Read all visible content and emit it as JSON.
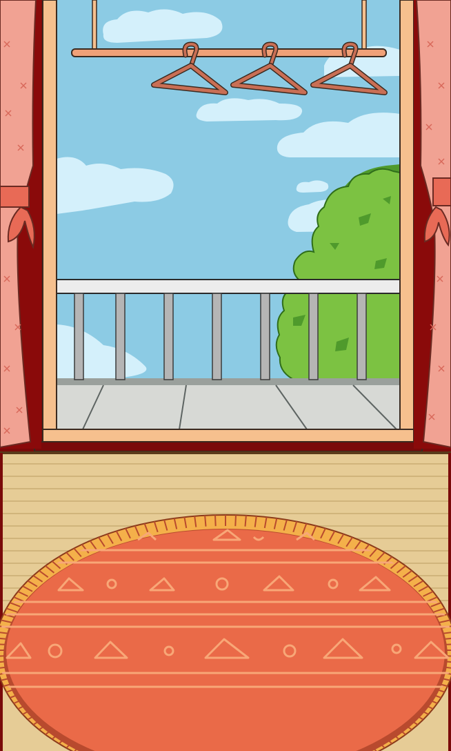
{
  "scene": {
    "name": "balcony-room",
    "hanger_count": 3,
    "railing_post_count": 7
  },
  "colors": {
    "sky": "#8ccbe4",
    "cloud": "#d4f0fb",
    "frame": "#f6c08e",
    "frame_shadow": "#d89a64",
    "wall": "#7a0a0a",
    "curtain": "#f1a293",
    "curtain_mark": "#d8685a",
    "tie": "#e86a56",
    "rod": "#f0a178",
    "hanger": "#c96f55",
    "railing_rail": "#ececec",
    "railing_post": "#b5b5b5",
    "balcony_floor": "#d7d9d5",
    "tree_light": "#7cc242",
    "tree_dark": "#4f9a2c",
    "wood_floor": "#e6cc96",
    "wood_line": "#c9ab72",
    "rug": "#ea6a48",
    "rug_border": "#b84a2e",
    "rug_fringe": "#f4b04a",
    "rug_pattern": "#f8a777"
  }
}
